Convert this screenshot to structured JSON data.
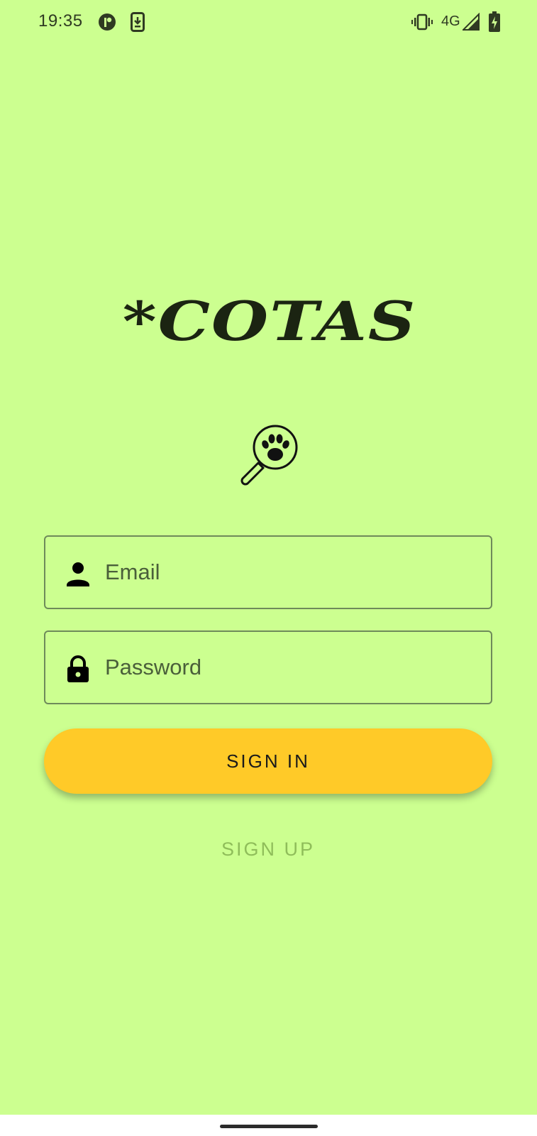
{
  "status_bar": {
    "time": "19:35",
    "network": "4G",
    "icons": [
      "app-notification-icon",
      "download-icon",
      "vibrate-icon",
      "signal-icon",
      "battery-charging-icon"
    ]
  },
  "logo": {
    "text": "*COTAS"
  },
  "login_form": {
    "email_placeholder": "Email",
    "email_value": "",
    "password_placeholder": "Password",
    "password_value": "",
    "email_icon": "person-icon",
    "password_icon": "lock-icon"
  },
  "buttons": {
    "sign_in": "SIGN IN",
    "sign_up": "SIGN UP"
  },
  "colors": {
    "background": "#ccff90",
    "primary_button": "#ffca28",
    "secondary_text": "#8fbd5a",
    "field_border": "#6e8a5a"
  }
}
